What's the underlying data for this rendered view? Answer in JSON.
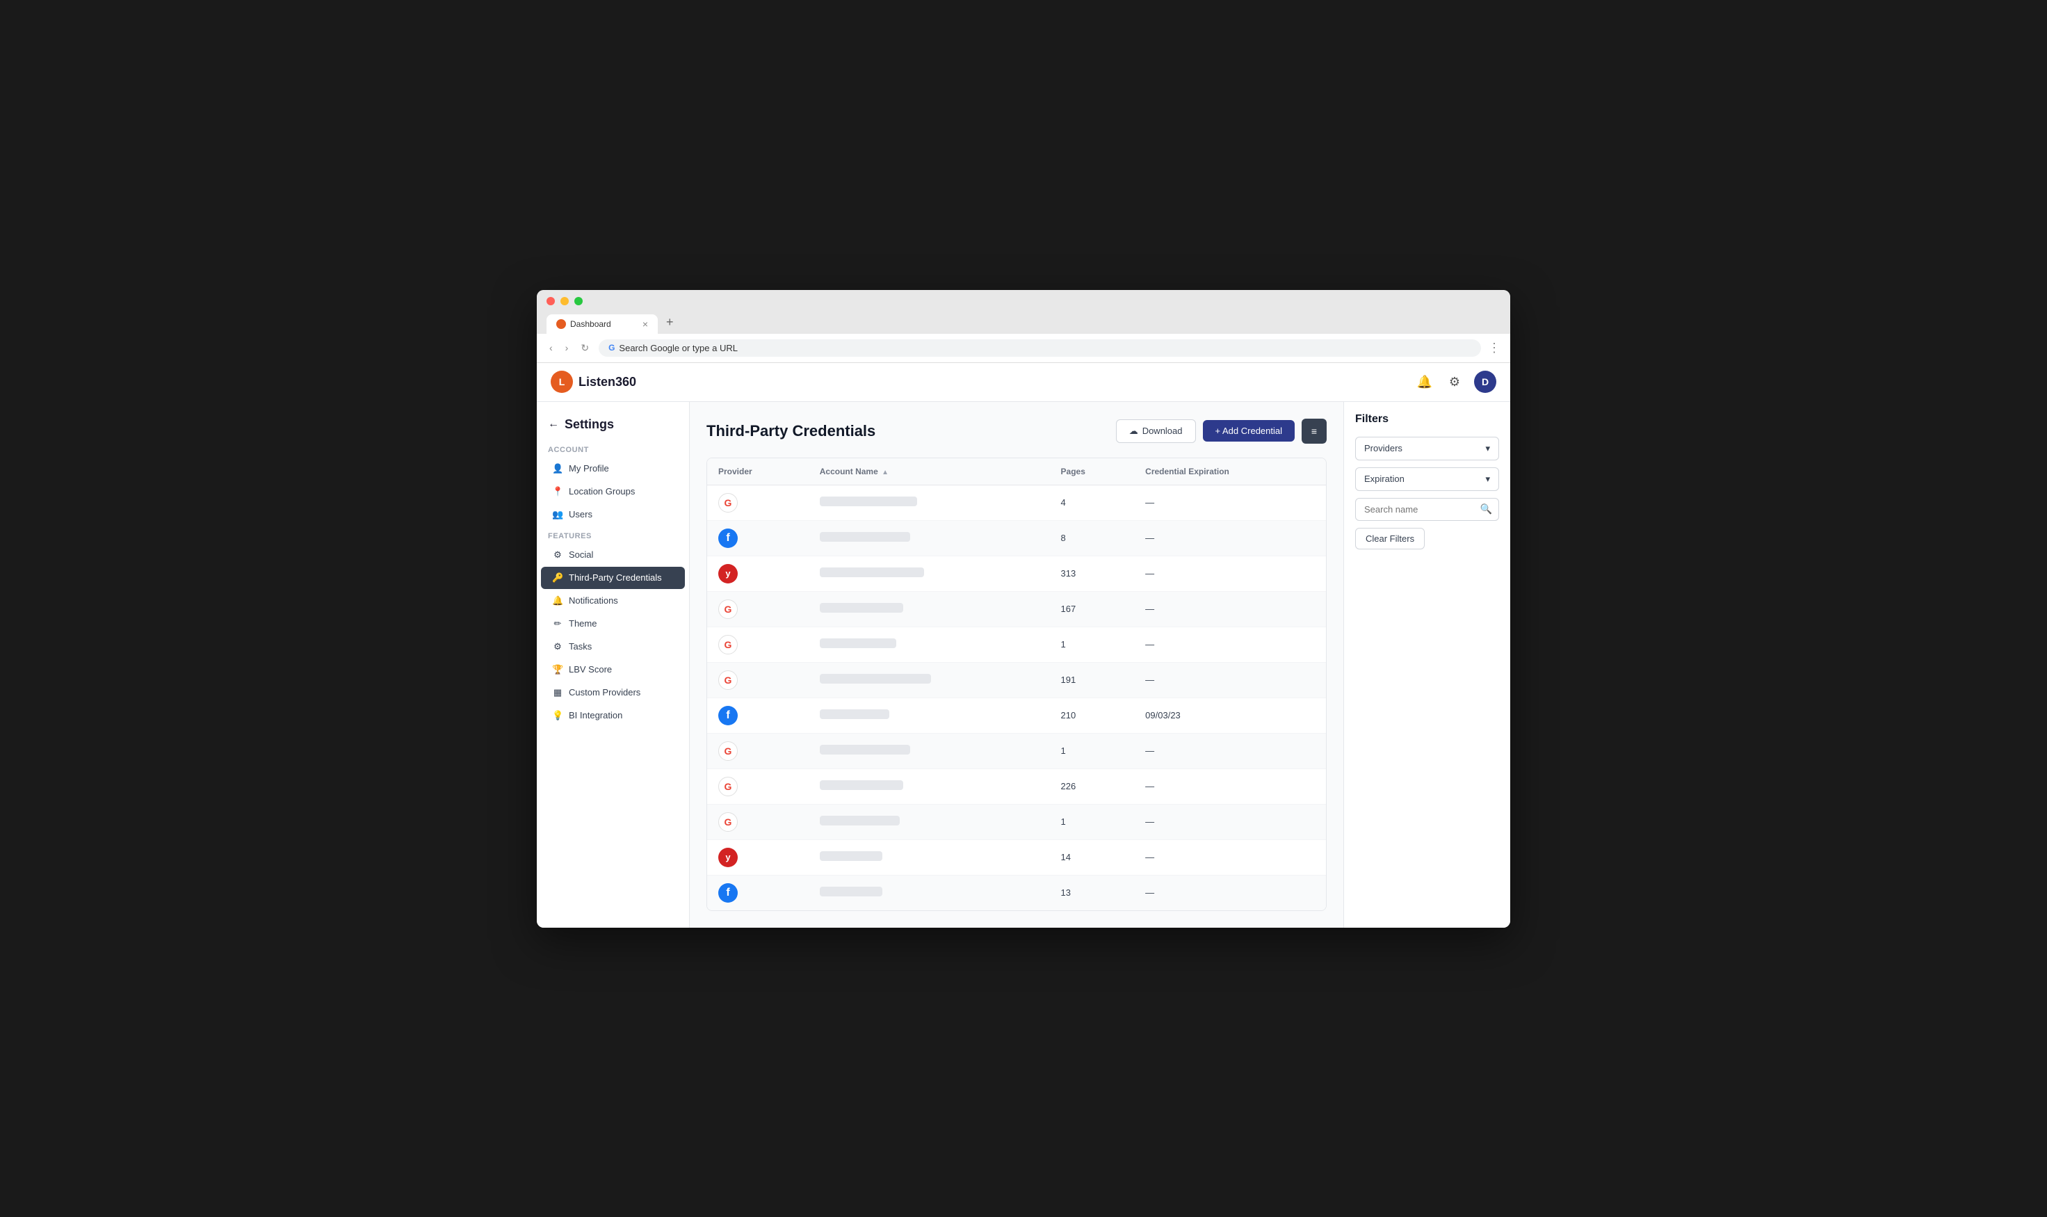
{
  "browser": {
    "tab_title": "Dashboard",
    "address": "Search Google or type a URL",
    "new_tab_icon": "+",
    "more_icon": "⋮"
  },
  "topnav": {
    "logo_text": "Listen360",
    "logo_initial": "L",
    "notification_icon": "🔔",
    "settings_icon": "⚙",
    "avatar_label": "D"
  },
  "sidebar": {
    "back_label": "Settings",
    "account_section": "Account",
    "features_section": "Features",
    "items": [
      {
        "id": "my-profile",
        "label": "My Profile",
        "icon": "👤"
      },
      {
        "id": "location-groups",
        "label": "Location Groups",
        "icon": "📍"
      },
      {
        "id": "users",
        "label": "Users",
        "icon": "👥"
      },
      {
        "id": "social",
        "label": "Social",
        "icon": "⚙"
      },
      {
        "id": "third-party-credentials",
        "label": "Third-Party Credentials",
        "icon": "🔑",
        "active": true
      },
      {
        "id": "notifications",
        "label": "Notifications",
        "icon": "🔔"
      },
      {
        "id": "theme",
        "label": "Theme",
        "icon": "✏"
      },
      {
        "id": "tasks",
        "label": "Tasks",
        "icon": "⚙"
      },
      {
        "id": "lbv-score",
        "label": "LBV Score",
        "icon": "🏆"
      },
      {
        "id": "custom-providers",
        "label": "Custom Providers",
        "icon": "▦"
      },
      {
        "id": "bi-integration",
        "label": "BI Integration",
        "icon": "💡"
      }
    ]
  },
  "page": {
    "title": "Third-Party Credentials",
    "download_btn": "Download",
    "add_btn": "+ Add Credential",
    "download_icon": "☁"
  },
  "table": {
    "columns": [
      {
        "id": "provider",
        "label": "Provider"
      },
      {
        "id": "account_name",
        "label": "Account Name",
        "sortable": true
      },
      {
        "id": "pages",
        "label": "Pages"
      },
      {
        "id": "credential_expiration",
        "label": "Credential Expiration"
      }
    ],
    "rows": [
      {
        "provider": "google",
        "account_name_width": 140,
        "pages": "4",
        "expiration": "—"
      },
      {
        "provider": "facebook",
        "account_name_width": 130,
        "pages": "8",
        "expiration": "—"
      },
      {
        "provider": "yelp",
        "account_name_width": 150,
        "pages": "313",
        "expiration": "—"
      },
      {
        "provider": "google",
        "account_name_width": 120,
        "pages": "167",
        "expiration": "—"
      },
      {
        "provider": "google",
        "account_name_width": 110,
        "pages": "1",
        "expiration": "—"
      },
      {
        "provider": "google",
        "account_name_width": 160,
        "pages": "191",
        "expiration": "—"
      },
      {
        "provider": "facebook",
        "account_name_width": 100,
        "pages": "210",
        "expiration": "09/03/23"
      },
      {
        "provider": "google",
        "account_name_width": 130,
        "pages": "1",
        "expiration": "—"
      },
      {
        "provider": "google",
        "account_name_width": 120,
        "pages": "226",
        "expiration": "—"
      },
      {
        "provider": "google",
        "account_name_width": 115,
        "pages": "1",
        "expiration": "—"
      },
      {
        "provider": "yelp",
        "account_name_width": 90,
        "pages": "14",
        "expiration": "—"
      },
      {
        "provider": "facebook",
        "account_name_width": 90,
        "pages": "13",
        "expiration": "—"
      }
    ]
  },
  "filters": {
    "title": "Filters",
    "providers_label": "Providers",
    "expiration_label": "Expiration",
    "search_placeholder": "Search name",
    "clear_btn": "Clear Filters"
  }
}
